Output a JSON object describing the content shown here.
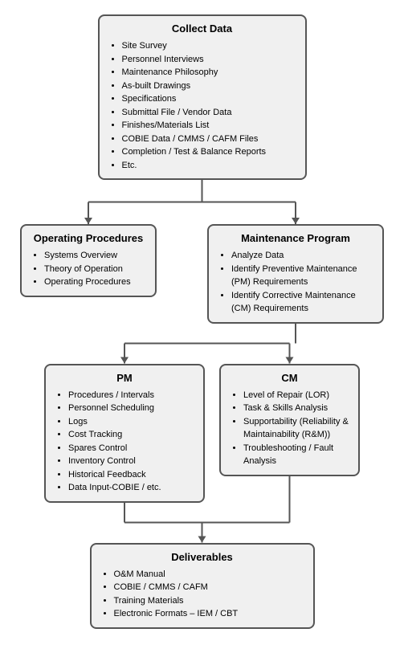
{
  "collect": {
    "title": "Collect Data",
    "items": [
      "Site Survey",
      "Personnel Interviews",
      "Maintenance Philosophy",
      "As-built Drawings",
      "Specifications",
      "Submittal File / Vendor Data",
      "Finishes/Materials List",
      "COBIE Data / CMMS / CAFM Files",
      "Completion / Test & Balance Reports",
      "Etc."
    ]
  },
  "operating": {
    "title": "Operating Procedures",
    "items": [
      "Systems Overview",
      "Theory of Operation",
      "Operating Procedures"
    ]
  },
  "maintenance": {
    "title": "Maintenance Program",
    "items": [
      "Analyze Data",
      "Identify Preventive Maintenance (PM) Requirements",
      "Identify Corrective Maintenance (CM) Requirements"
    ]
  },
  "pm": {
    "title": "PM",
    "items": [
      "Procedures / Intervals",
      "Personnel Scheduling",
      "Logs",
      "Cost Tracking",
      "Spares Control",
      "Inventory Control",
      "Historical Feedback",
      "Data Input-COBIE / etc."
    ]
  },
  "cm": {
    "title": "CM",
    "items": [
      "Level of Repair (LOR)",
      "Task & Skills Analysis",
      "Supportability (Reliability & Maintainability (R&M))",
      "Troubleshooting / Fault Analysis"
    ]
  },
  "deliverables": {
    "title": "Deliverables",
    "items": [
      "O&M Manual",
      "COBIE / CMMS / CAFM",
      "Training Materials",
      "Electronic Formats – IEM / CBT"
    ]
  }
}
